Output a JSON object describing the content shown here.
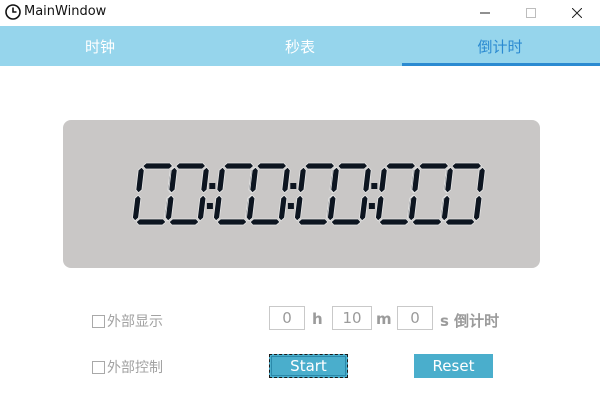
{
  "window": {
    "title": "MainWindow"
  },
  "tabs": [
    {
      "label": "时钟",
      "active": false
    },
    {
      "label": "秒表",
      "active": false
    },
    {
      "label": "倒计时",
      "active": true
    }
  ],
  "display": {
    "time": "00:00:00:000"
  },
  "options": {
    "external_display_label": "外部显示",
    "external_display_checked": false,
    "external_control_label": "外部控制",
    "external_control_checked": false
  },
  "countdown": {
    "hours": "0",
    "hours_unit": "h",
    "minutes": "10",
    "minutes_unit": "m",
    "seconds": "0",
    "seconds_unit": "s 倒计时"
  },
  "buttons": {
    "start": "Start",
    "reset": "Reset"
  },
  "colors": {
    "tab_bar": "#96d5ec",
    "tab_active": "#2b8ad1",
    "lcd_bg": "#c9c7c6",
    "lcd_digit": "#0d1520",
    "button": "#4aaecc"
  }
}
